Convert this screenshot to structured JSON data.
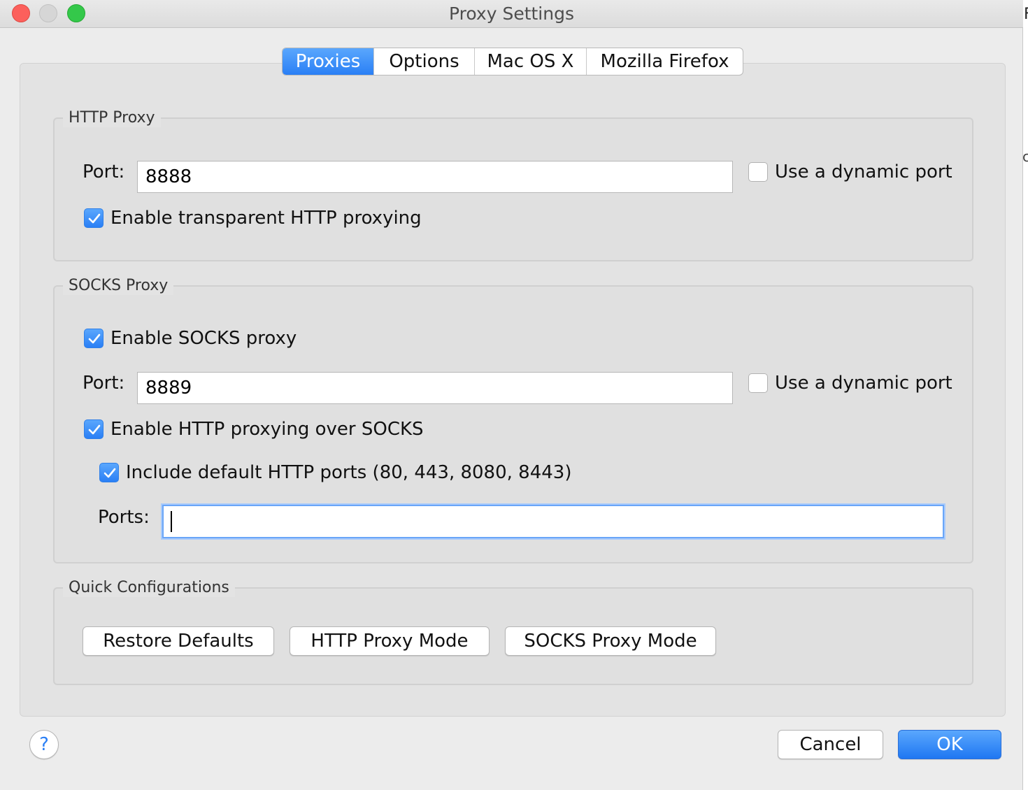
{
  "window": {
    "title": "Proxy Settings"
  },
  "edge_glyphs": {
    "top": "F",
    "middle": "c"
  },
  "tabs": [
    {
      "label": "Proxies",
      "active": true
    },
    {
      "label": "Options",
      "active": false
    },
    {
      "label": "Mac OS X",
      "active": false
    },
    {
      "label": "Mozilla Firefox",
      "active": false
    }
  ],
  "http_proxy": {
    "legend": "HTTP Proxy",
    "port_label": "Port:",
    "port_value": "8888",
    "dynamic_port_label": "Use a dynamic port",
    "dynamic_port_checked": false,
    "transparent_label": "Enable transparent HTTP proxying",
    "transparent_checked": true
  },
  "socks_proxy": {
    "legend": "SOCKS Proxy",
    "enable_label": "Enable SOCKS proxy",
    "enable_checked": true,
    "port_label": "Port:",
    "port_value": "8889",
    "dynamic_port_label": "Use a dynamic port",
    "dynamic_port_checked": false,
    "http_over_socks_label": "Enable HTTP proxying over SOCKS",
    "http_over_socks_checked": true,
    "include_default_label": "Include default HTTP ports (80, 443, 8080, 8443)",
    "include_default_checked": true,
    "ports_label": "Ports:",
    "ports_value": ""
  },
  "quick_config": {
    "legend": "Quick Configurations",
    "restore_label": "Restore Defaults",
    "http_mode_label": "HTTP Proxy Mode",
    "socks_mode_label": "SOCKS Proxy Mode"
  },
  "footer": {
    "help_label": "?",
    "cancel_label": "Cancel",
    "ok_label": "OK"
  },
  "colors": {
    "accent": "#2a7ff5",
    "window_bg": "#ececec"
  }
}
